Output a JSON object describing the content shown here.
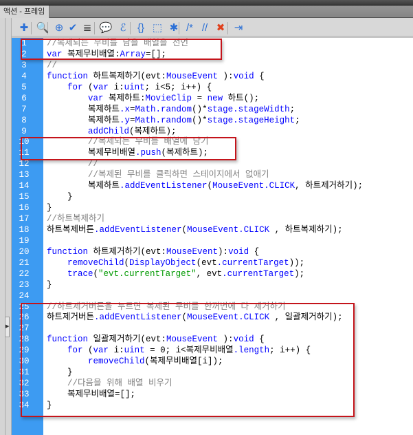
{
  "panel": {
    "tab_title": "액션 - 프레임"
  },
  "toolbar": [
    {
      "name": "add-new-item-icon",
      "glyph": "✚"
    },
    {
      "name": "find-icon",
      "glyph": "🔍"
    },
    {
      "name": "insert-target-path-icon",
      "glyph": "⊕"
    },
    {
      "name": "check-syntax-icon",
      "glyph": "✔"
    },
    {
      "name": "auto-format-icon",
      "glyph": "≣"
    },
    {
      "name": "show-code-hint-icon",
      "glyph": "💬"
    },
    {
      "name": "debug-options-icon",
      "glyph": "ℰ"
    },
    {
      "name": "collapse-between-braces-icon",
      "glyph": "{}"
    },
    {
      "name": "collapse-selection-icon",
      "glyph": "⬚"
    },
    {
      "name": "expand-all-icon",
      "glyph": "✱"
    },
    {
      "name": "apply-block-comment-icon",
      "glyph": "/*"
    },
    {
      "name": "apply-line-comment-icon",
      "glyph": "//"
    },
    {
      "name": "remove-comment-icon",
      "glyph": "✖"
    },
    {
      "name": "show-hide-toolbox-icon",
      "glyph": "⇥"
    }
  ],
  "colors": {
    "gutter": "#3d9bf2",
    "keyword": "#0000ff",
    "comment": "#808080",
    "string": "#009900",
    "highlight_box": "#c4141b"
  },
  "code": [
    [
      [
        "//복제되는 무비를 담을 배열을 선언",
        "c"
      ]
    ],
    [
      [
        "var",
        "k"
      ],
      [
        " 복제무비배열:",
        ""
      ],
      [
        "Array",
        "k"
      ],
      [
        "=[];",
        ""
      ]
    ],
    [
      [
        "//",
        "c"
      ]
    ],
    [
      [
        "function",
        "k"
      ],
      [
        " 하트복제하기(evt:",
        ""
      ],
      [
        "MouseEvent",
        "k"
      ],
      [
        " ):",
        ""
      ],
      [
        "void",
        "k"
      ],
      [
        " {",
        ""
      ]
    ],
    [
      [
        "    ",
        ""
      ],
      [
        "for",
        "k"
      ],
      [
        " (",
        ""
      ],
      [
        "var",
        "k"
      ],
      [
        " i:",
        ""
      ],
      [
        "uint",
        "k"
      ],
      [
        "; i<5; i++) {",
        ""
      ]
    ],
    [
      [
        "        ",
        ""
      ],
      [
        "var",
        "k"
      ],
      [
        " 복제하트:",
        ""
      ],
      [
        "MovieClip",
        "k"
      ],
      [
        " = ",
        ""
      ],
      [
        "new",
        "k"
      ],
      [
        " 하트();",
        ""
      ]
    ],
    [
      [
        "        복제하트",
        ""
      ],
      [
        ".x",
        "k"
      ],
      [
        "=",
        ""
      ],
      [
        "Math.random",
        "k"
      ],
      [
        "()*",
        ""
      ],
      [
        "stage.stageWidth",
        "k"
      ],
      [
        ";",
        ""
      ]
    ],
    [
      [
        "        복제하트",
        ""
      ],
      [
        ".y",
        "k"
      ],
      [
        "=",
        ""
      ],
      [
        "Math.random",
        "k"
      ],
      [
        "()*",
        ""
      ],
      [
        "stage.stageHeight",
        "k"
      ],
      [
        ";",
        ""
      ]
    ],
    [
      [
        "        ",
        ""
      ],
      [
        "addChild",
        "k"
      ],
      [
        "(복제하트);",
        ""
      ]
    ],
    [
      [
        "        ",
        ""
      ],
      [
        "//복제되는 무비를 배열에 담기",
        "c"
      ]
    ],
    [
      [
        "        복제무비배열",
        ""
      ],
      [
        ".push",
        "k"
      ],
      [
        "(복제하트);",
        ""
      ]
    ],
    [
      [
        "        ",
        ""
      ],
      [
        "//",
        "c"
      ]
    ],
    [
      [
        "        ",
        ""
      ],
      [
        "//복제된 무비를 클릭하면 스테이지에서 없애기",
        "c"
      ]
    ],
    [
      [
        "        복제하트",
        ""
      ],
      [
        ".addEventListener",
        "k"
      ],
      [
        "(",
        ""
      ],
      [
        "MouseEvent.CLICK",
        "k"
      ],
      [
        ", 하트제거하기);",
        ""
      ]
    ],
    [
      [
        "    }",
        ""
      ]
    ],
    [
      [
        "}",
        ""
      ]
    ],
    [
      [
        "//하트복제하기",
        "c"
      ]
    ],
    [
      [
        "하트복제버튼",
        ""
      ],
      [
        ".addEventListener",
        "k"
      ],
      [
        "(",
        ""
      ],
      [
        "MouseEvent.CLICK",
        "k"
      ],
      [
        " , 하트복제하기);",
        ""
      ]
    ],
    [
      [
        "",
        ""
      ]
    ],
    [
      [
        "function",
        "k"
      ],
      [
        " 하트제거하기(evt:",
        ""
      ],
      [
        "MouseEvent",
        "k"
      ],
      [
        "):",
        ""
      ],
      [
        "void",
        "k"
      ],
      [
        " {",
        ""
      ]
    ],
    [
      [
        "    ",
        ""
      ],
      [
        "removeChild",
        "k"
      ],
      [
        "(",
        ""
      ],
      [
        "DisplayObject",
        "k"
      ],
      [
        "(evt",
        ""
      ],
      [
        ".currentTarget",
        "k"
      ],
      [
        "));",
        ""
      ]
    ],
    [
      [
        "    ",
        ""
      ],
      [
        "trace",
        "k"
      ],
      [
        "(",
        ""
      ],
      [
        "\"evt.currentTarget\"",
        "s"
      ],
      [
        ", evt",
        ""
      ],
      [
        ".currentTarget",
        "k"
      ],
      [
        ");",
        ""
      ]
    ],
    [
      [
        "}",
        ""
      ]
    ],
    [
      [
        "",
        ""
      ]
    ],
    [
      [
        "//하트제거버튼을 누르면 복제된 무비를 한꺼번에 다 제거하기",
        "c"
      ]
    ],
    [
      [
        "하트제거버튼",
        ""
      ],
      [
        ".addEventListener",
        "k"
      ],
      [
        "(",
        ""
      ],
      [
        "MouseEvent.CLICK",
        "k"
      ],
      [
        " , 일괄제거하기);",
        ""
      ]
    ],
    [
      [
        "",
        ""
      ]
    ],
    [
      [
        "function",
        "k"
      ],
      [
        " 일괄제거하기(evt:",
        ""
      ],
      [
        "MouseEvent",
        "k"
      ],
      [
        " ):",
        ""
      ],
      [
        "void",
        "k"
      ],
      [
        " {",
        ""
      ]
    ],
    [
      [
        "    ",
        ""
      ],
      [
        "for",
        "k"
      ],
      [
        " (",
        ""
      ],
      [
        "var",
        "k"
      ],
      [
        " i:",
        ""
      ],
      [
        "uint",
        "k"
      ],
      [
        " = 0; i<복제무비배열",
        ""
      ],
      [
        ".length",
        "k"
      ],
      [
        "; i++) {",
        ""
      ]
    ],
    [
      [
        "        ",
        ""
      ],
      [
        "removeChild",
        "k"
      ],
      [
        "(복제무비배열[i]);",
        ""
      ]
    ],
    [
      [
        "    }",
        ""
      ]
    ],
    [
      [
        "    ",
        ""
      ],
      [
        "//다음을 위해 배열 비우기",
        "c"
      ]
    ],
    [
      [
        "    복제무비배열=[];",
        ""
      ]
    ],
    [
      [
        "}",
        ""
      ]
    ]
  ]
}
